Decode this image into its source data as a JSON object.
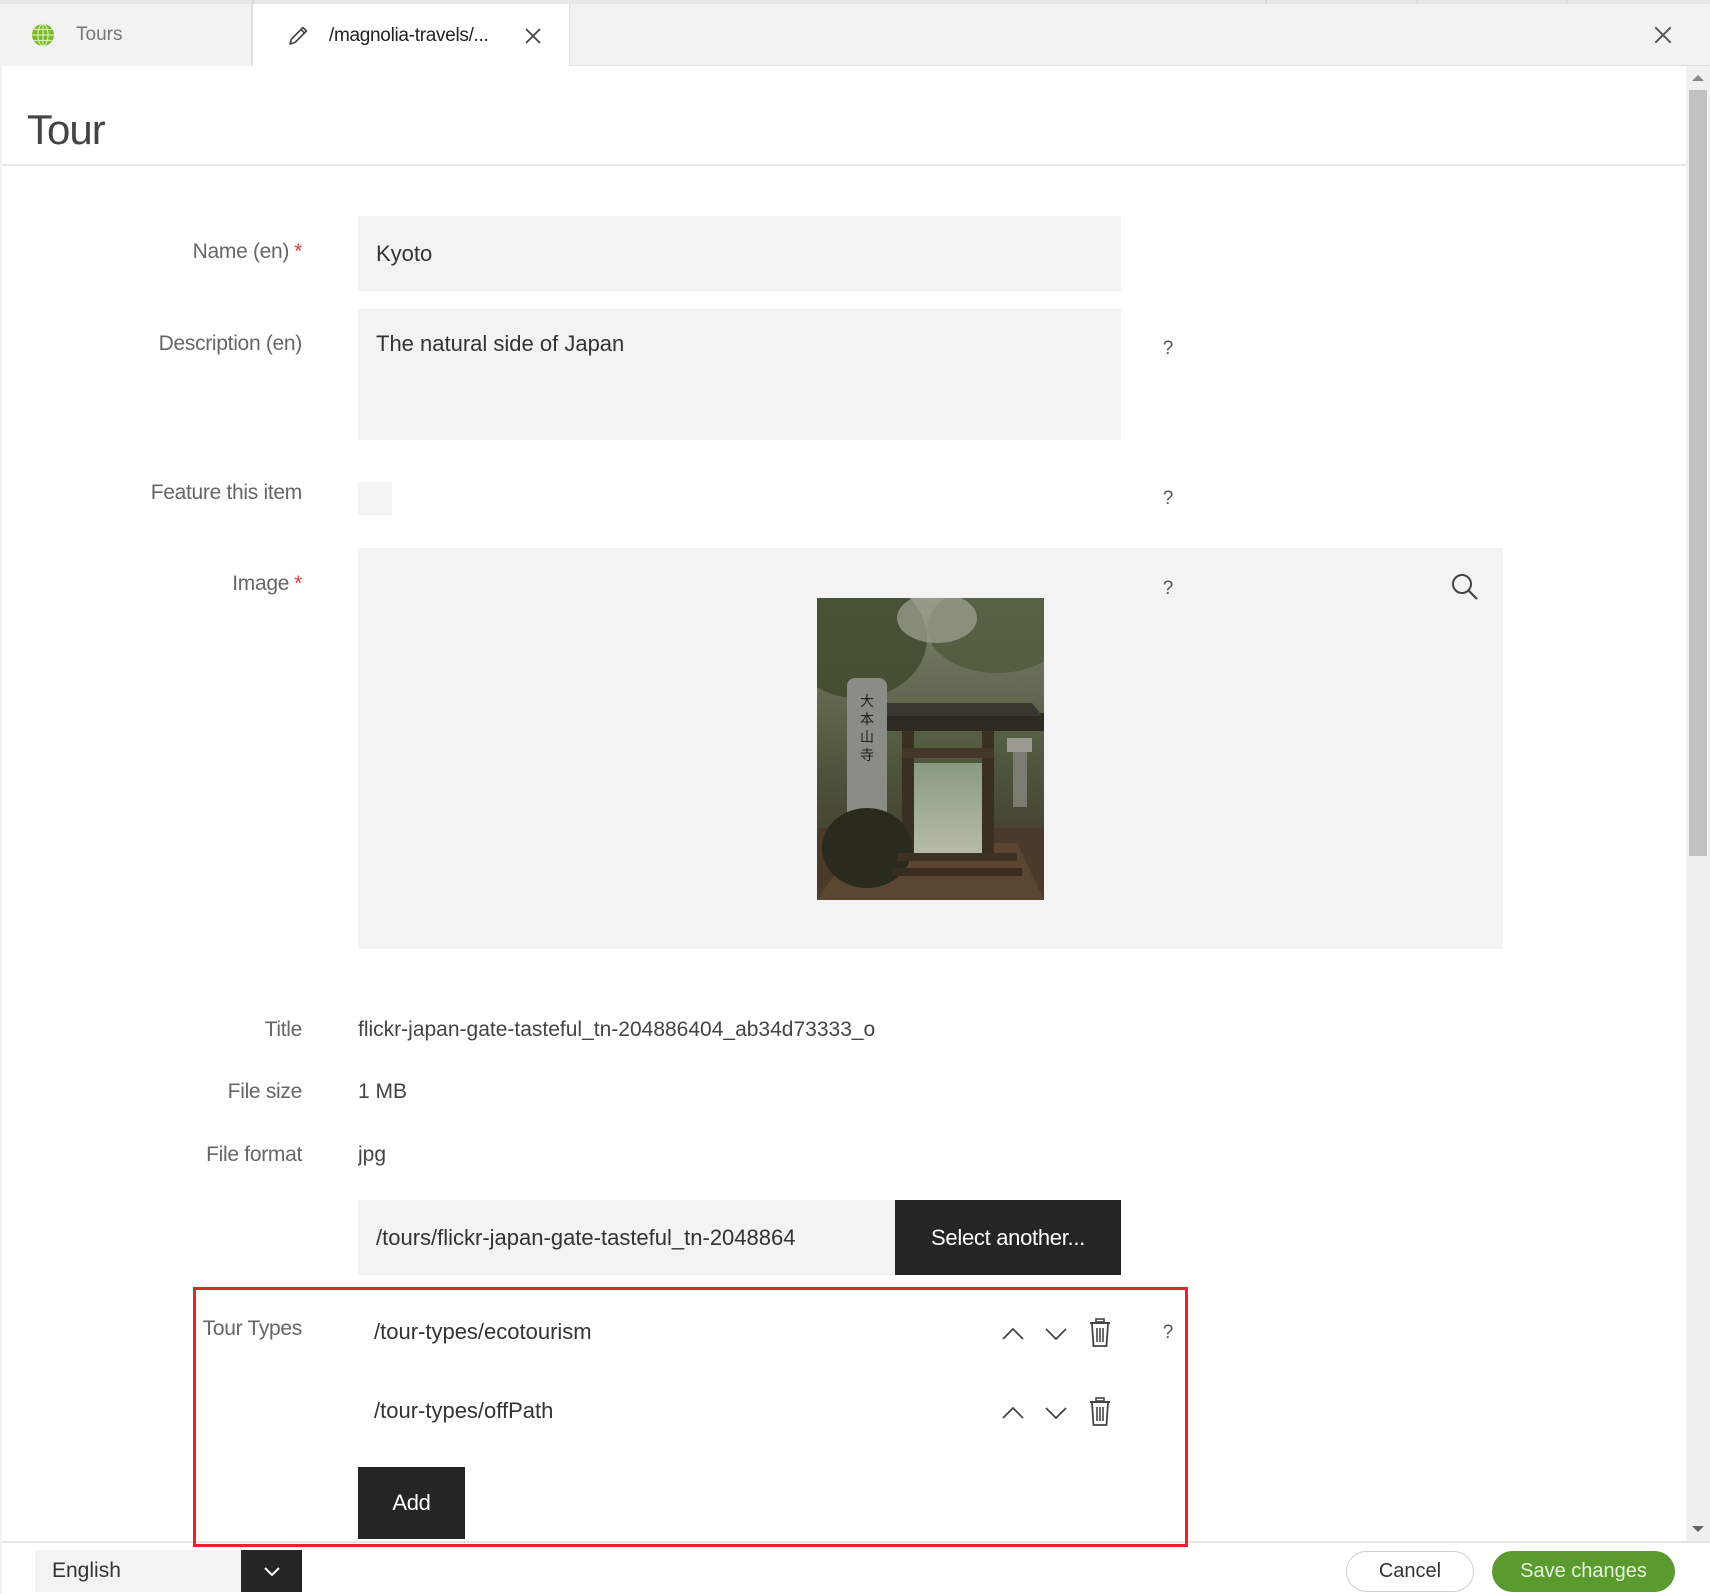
{
  "tabs": [
    {
      "label": "Tours",
      "icon": "globe-icon"
    },
    {
      "label": "/magnolia-travels/...",
      "icon": "pencil-icon",
      "active": true
    }
  ],
  "dialog": {
    "title": "Tour"
  },
  "form": {
    "name": {
      "label": "Name (en)",
      "required": "*",
      "value": "Kyoto"
    },
    "description": {
      "label": "Description (en)",
      "value": "The natural side of Japan",
      "help": "?"
    },
    "feature": {
      "label": "Feature this item",
      "checked": false,
      "help": "?"
    },
    "image": {
      "label": "Image",
      "required": "*",
      "help": "?",
      "preview_alt": "Japanese temple gate in misty forest",
      "title_label": "Title",
      "title_value": "flickr-japan-gate-tasteful_tn-204886404_ab34d73333_o",
      "size_label": "File size",
      "size_value": "1 MB",
      "format_label": "File format",
      "format_value": "jpg",
      "path_value": "/tours/flickr-japan-gate-tasteful_tn-2048864",
      "select_label": "Select another..."
    },
    "tour_types": {
      "label": "Tour Types",
      "help": "?",
      "items": [
        {
          "value": "/tour-types/ecotourism"
        },
        {
          "value": "/tour-types/offPath"
        }
      ],
      "add_label": "Add"
    }
  },
  "footer": {
    "language": "English",
    "cancel_label": "Cancel",
    "save_label": "Save changes"
  },
  "colors": {
    "accent_green": "#5a9a2e",
    "highlight_red": "#e3262b",
    "dark_button": "#252525",
    "field_bg": "#f3f3f3"
  }
}
